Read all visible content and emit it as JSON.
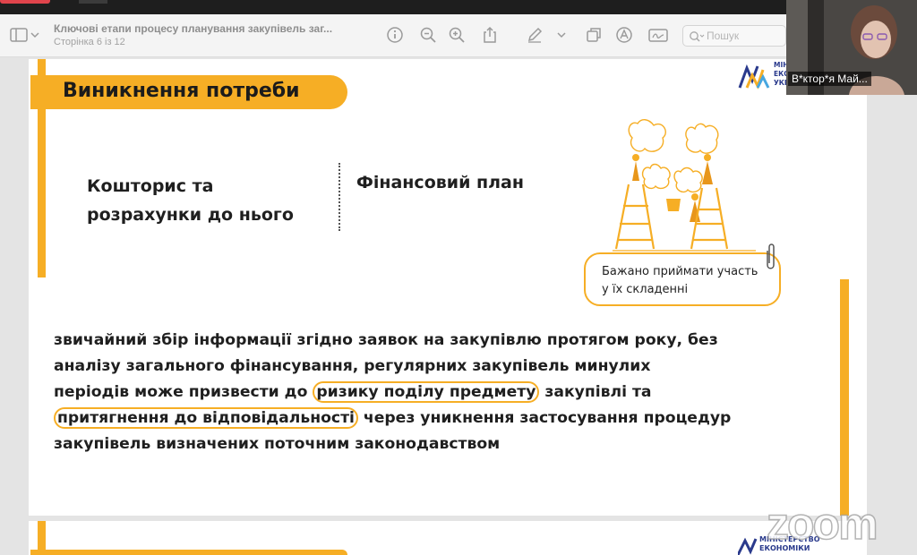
{
  "viewer": {
    "doc_title": "Ключові етапи процесу планування закупівель заг...",
    "page_info": "Сторінка 6 із 12",
    "search_placeholder": "Пошук"
  },
  "slide": {
    "heading": "Виникнення потреби",
    "col1_line1": "Кошторис та",
    "col1_line2": "розрахунки до нього",
    "col2": "Фінансовий план",
    "note_line1": "Бажано приймати участь",
    "note_line2": "у їх складенні",
    "body": {
      "line1": "звичайний збір інформації згідно заявок на закупівлю протягом року, без",
      "line2": "аналізу загального фінансування, регулярних закупівель минулих",
      "line3_pre": "періодів може призвести до ",
      "line3_hl": "ризику поділу предмету",
      "line3_post": " закупівлі та",
      "line4_hl": "притягнення до відповідальності",
      "line4_post": " через уникнення застосування процедур",
      "line5": "закупівель визначених поточним законодавством"
    },
    "logo_text": [
      "МІН",
      "ЕКО",
      "УКР"
    ],
    "next_logo_text": [
      "МІНІСТЕРСТВО",
      "ЕКОНОМІКИ"
    ]
  },
  "video": {
    "participant": "В*ктор*я Май..."
  },
  "watermark": "zoom",
  "colors": {
    "accent": "#f6ae25",
    "logo_blue": "#2a3a8c"
  },
  "icons": [
    "sidebar-icon",
    "chevron-down-icon",
    "info-icon",
    "zoom-out-icon",
    "zoom-in-icon",
    "share-icon",
    "pen-icon",
    "chevron-down-icon",
    "copy-icon",
    "markup-icon",
    "signature-icon",
    "search-icon",
    "paperclip-icon"
  ]
}
